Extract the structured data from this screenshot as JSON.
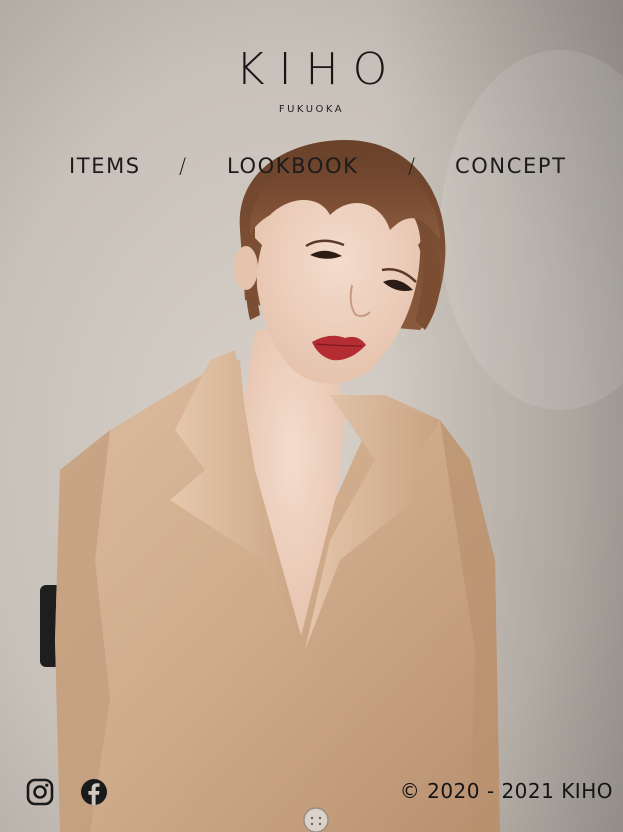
{
  "brand": {
    "name": "KIHO",
    "location": "FUKUOKA"
  },
  "nav": {
    "items": [
      {
        "label": "ITEMS"
      },
      {
        "label": "LOOKBOOK"
      },
      {
        "label": "CONCEPT"
      }
    ],
    "separator": "/"
  },
  "hero": {
    "icon": "model-photo",
    "colors": {
      "wall": "#cbc4bc",
      "jacket": "#d6b496",
      "hair": "#7b4d33",
      "skin": "#efd4c3",
      "lip": "#b32d33"
    }
  },
  "footer": {
    "social": [
      {
        "icon": "instagram-icon"
      },
      {
        "icon": "facebook-icon"
      }
    ],
    "copyright": "© 2020 - 2021 KIHO"
  }
}
